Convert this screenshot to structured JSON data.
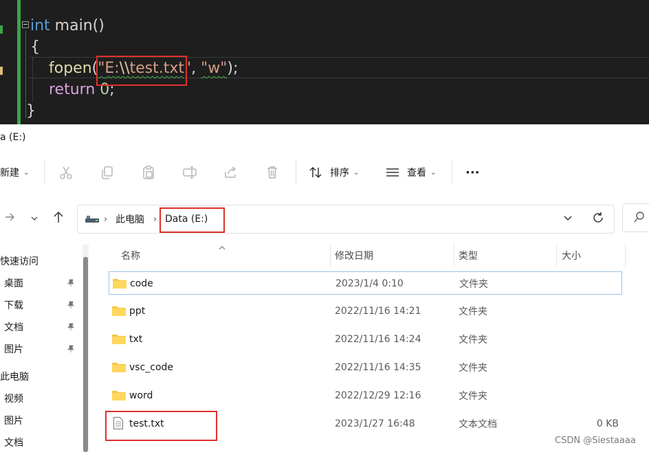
{
  "editor": {
    "line1": {
      "type": "int",
      "rest": " main()"
    },
    "line2": "{",
    "line3": {
      "fn": "fopen",
      "open": "(",
      "q1": "\"",
      "path_a": "E:",
      "path_esc": "\\\\",
      "path_b": "test.txt",
      "q2": "\"",
      "comma": ", ",
      "mode": "\"w\"",
      "close": ");"
    },
    "line4": {
      "kw": "return",
      "num": " 0",
      "end": ";"
    },
    "line5": "}"
  },
  "explorer": {
    "window_title": "a (E:)",
    "toolbar": {
      "new_label": "新建",
      "sort_label": "排序",
      "view_label": "查看",
      "more_label": "···"
    },
    "breadcrumb": [
      "此电脑",
      "Data (E:)"
    ],
    "sidebar": {
      "quick_access": "快速访问",
      "pinned": [
        "桌面",
        "下载",
        "文档",
        "图片"
      ],
      "this_pc": "此电脑",
      "pc_items": [
        "视频",
        "图片",
        "文档"
      ]
    },
    "columns": {
      "name": "名称",
      "date": "修改日期",
      "type": "类型",
      "size": "大小"
    },
    "files": [
      {
        "name": "code",
        "date": "2023/1/4 0:10",
        "type": "文件夹",
        "size": "",
        "kind": "folder"
      },
      {
        "name": "ppt",
        "date": "2022/11/16 14:21",
        "type": "文件夹",
        "size": "",
        "kind": "folder"
      },
      {
        "name": "txt",
        "date": "2022/11/16 14:24",
        "type": "文件夹",
        "size": "",
        "kind": "folder"
      },
      {
        "name": "vsc_code",
        "date": "2022/11/16 14:35",
        "type": "文件夹",
        "size": "",
        "kind": "folder"
      },
      {
        "name": "word",
        "date": "2022/12/29 12:16",
        "type": "文件夹",
        "size": "",
        "kind": "folder"
      },
      {
        "name": "test.txt",
        "date": "2023/1/27 16:48",
        "type": "文本文档",
        "size": "0 KB",
        "kind": "file"
      }
    ]
  },
  "watermark": "CSDN @Siestaaaa",
  "colors": {
    "highlight": "#e0302a",
    "editor_bg": "#1e1e1e",
    "folder": "#f4c542",
    "selection": "#99c4e8"
  }
}
